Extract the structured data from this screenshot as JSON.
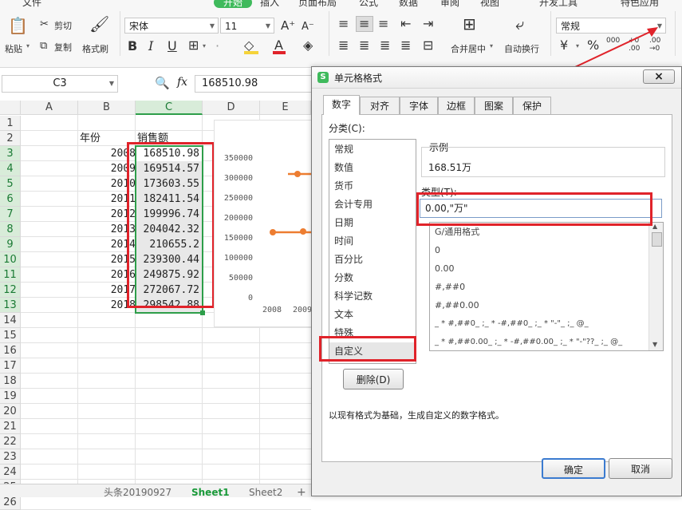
{
  "menu": {
    "file": "文件",
    "start": "开始",
    "insert": "插入",
    "page_layout": "页面布局",
    "formula": "公式",
    "data": "数据",
    "review": "审阅",
    "view": "视图",
    "dev": "开发工具",
    "special": "特色应用"
  },
  "ribbon": {
    "cut": "剪切",
    "copy": "复制",
    "paste": "粘贴",
    "format_painter": "格式刷",
    "font_name": "宋体",
    "font_size": "11",
    "bold": "B",
    "italic": "I",
    "underline": "U",
    "merge_center": "合并居中",
    "wrap_text": "自动换行",
    "number_format": "常规",
    "percent": "%",
    "thousands": "000",
    "inc_decimal": "+0 .00",
    "dec_decimal": ".00 →0"
  },
  "formula_bar": {
    "cell_ref": "C3",
    "fx": "fx",
    "value": "168510.98"
  },
  "sheet": {
    "columns": [
      "A",
      "B",
      "C",
      "D",
      "E"
    ],
    "rows": [
      "1",
      "2",
      "3",
      "4",
      "5",
      "6",
      "7",
      "8",
      "9",
      "10",
      "11",
      "12",
      "13",
      "14",
      "15",
      "16",
      "17",
      "18",
      "19",
      "20",
      "21",
      "22",
      "23",
      "24",
      "25",
      "26"
    ],
    "header_year": "年份",
    "header_sales": "销售额",
    "years": [
      "2008",
      "2009",
      "2010",
      "2011",
      "2012",
      "2013",
      "2014",
      "2015",
      "2016",
      "2017",
      "2018"
    ],
    "sales": [
      "168510.98",
      "169514.57",
      "173603.55",
      "182411.54",
      "199996.74",
      "204042.32",
      "210655.2",
      "239300.44",
      "249875.92",
      "272067.72",
      "298542.88"
    ]
  },
  "chart_data": {
    "type": "line",
    "y_ticks": [
      "350000",
      "300000",
      "250000",
      "200000",
      "150000",
      "100000",
      "50000",
      "0"
    ],
    "x_ticks": [
      "2008",
      "2009"
    ],
    "ylim": [
      0,
      350000
    ]
  },
  "sheet_tabs": {
    "tab1": "头条20190927",
    "tab2": "Sheet1",
    "tab3": "Sheet2",
    "add": "+"
  },
  "dialog": {
    "title": "单元格格式",
    "close": "×",
    "tabs": [
      "数字",
      "对齐",
      "字体",
      "边框",
      "图案",
      "保护"
    ],
    "category_label": "分类(C):",
    "categories": [
      "常规",
      "数值",
      "货币",
      "会计专用",
      "日期",
      "时间",
      "百分比",
      "分数",
      "科学记数",
      "文本",
      "特殊",
      "自定义"
    ],
    "sample_label": "示例",
    "sample_value": "168.51万",
    "type_label": "类型(T):",
    "type_value": "0.00,\"万\"",
    "type_list": [
      "G/通用格式",
      "0",
      "0.00",
      "#,##0",
      "#,##0.00",
      "_ * #,##0_ ;_ * -#,##0_ ;_ * \"-\"_ ;_ @_",
      "_ * #,##0.00_ ;_ * -#,##0.00_ ;_ * \"-\"??_ ;_ @_"
    ],
    "delete_button": "删除(D)",
    "hint": "以现有格式为基础，生成自定义的数字格式。",
    "ok_button": "确定",
    "cancel_button": "取消"
  },
  "colors": {
    "accent_green": "#3fba5c",
    "highlight_red": "#e0232a",
    "selection_green": "#2e9e4a",
    "line_orange": "#ed7d31"
  }
}
